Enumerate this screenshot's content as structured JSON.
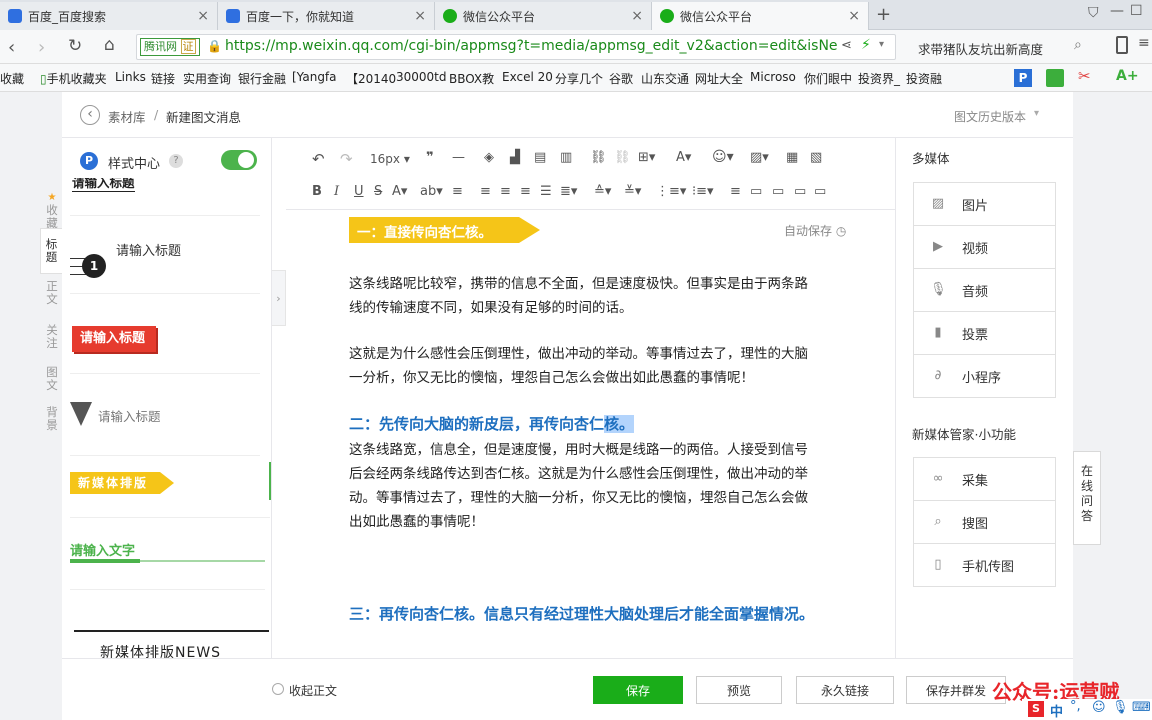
{
  "tabs": [
    {
      "label": "百度_百度搜索",
      "icon": "paw-icon"
    },
    {
      "label": "百度一下，你就知道",
      "icon": "paw-icon"
    },
    {
      "label": "微信公众平台",
      "icon": "wechat-icon"
    },
    {
      "label": "微信公众平台",
      "icon": "wechat-icon"
    }
  ],
  "address": {
    "badge": "腾讯网",
    "badge_tag": "证",
    "url": "https://mp.weixin.qq.com/cgi-bin/appmsg?t=media/appmsg_edit_v2&action=edit&isNe",
    "search_text": "求带猪队友坑出新高度"
  },
  "bookmarks": [
    "收藏",
    "手机收藏夹",
    "Links",
    "链接",
    "实用查询",
    "银行金融",
    "[Yangfa",
    "【20140",
    "30000td",
    "BBOX教",
    "Excel 20",
    "分享几个",
    "谷歌",
    "山东交通",
    "网址大全",
    "Microso",
    "你们眼中",
    "投资界_",
    "投资融"
  ],
  "breadcrumb": {
    "root": "素材库",
    "sep": "/",
    "current": "新建图文消息",
    "history": "图文历史版本"
  },
  "style_center": {
    "label": "样式中心",
    "help": "?"
  },
  "side_tabs": [
    "收藏",
    "标题",
    "正文",
    "关注",
    "图文",
    "背景"
  ],
  "style_items": {
    "item0": "请输入标题",
    "item1_num": "1",
    "item1": "请输入标题",
    "item2": "请输入标题",
    "item3": "请输入标题",
    "item4": "新媒体排版",
    "item5": "请输入文字",
    "item6": "新媒体排版NEWS"
  },
  "toolbar": {
    "font_size": "16px"
  },
  "autosave": "自动保存",
  "content": {
    "heading1": "一：直接传向杏仁核。",
    "para1": "这条线路呢比较窄，携带的信息不全面，但是速度极快。但事实是由于两条路线的传输速度不同，如果没有足够的时间的话。",
    "para2": "这就是为什么感性会压倒理性，做出冲动的举动。等事情过去了，理性的大脑一分析，你又无比的懊恼，埋怨自己怎么会做出如此愚蠢的事情呢！",
    "heading2a": "二：先传向大脑的新皮层，再传向杏仁",
    "heading2b": "核。",
    "para3": "这条线路宽，信息全，但是速度慢，用时大概是线路一的两倍。人接受到信号后会经两条线路传达到杏仁核。这就是为什么感性会压倒理性，做出冲动的举动。等事情过去了，理性的大脑一分析，你又无比的懊恼，埋怨自己怎么会做出如此愚蠢的事情呢！",
    "heading3": "三：再传向杏仁核。信息只有经过理性大脑处理后才能全面掌握情况。"
  },
  "right_panel": {
    "media_title": "多媒体",
    "media": [
      {
        "label": "图片",
        "icon": "image-icon"
      },
      {
        "label": "视频",
        "icon": "video-icon"
      },
      {
        "label": "音频",
        "icon": "microphone-icon"
      },
      {
        "label": "投票",
        "icon": "bar-chart-icon"
      },
      {
        "label": "小程序",
        "icon": "link-icon"
      }
    ],
    "tools_title": "新媒体管家·小功能",
    "tools": [
      {
        "label": "采集",
        "icon": "link-chain-icon"
      },
      {
        "label": "搜图",
        "icon": "search-icon"
      },
      {
        "label": "手机传图",
        "icon": "phone-upload-icon"
      }
    ]
  },
  "online_qa": "在线问答",
  "bottom": {
    "collapse": "收起正文",
    "save": "保存",
    "preview": "预览",
    "permalink": "永久链接",
    "save_send": "保存并群发"
  },
  "watermark": "公众号:运营贼",
  "ime": "中",
  "colors": {
    "green": "#1aad19",
    "blue": "#1e6fbf",
    "yellow": "#f5c518",
    "red": "#e63b2e"
  }
}
